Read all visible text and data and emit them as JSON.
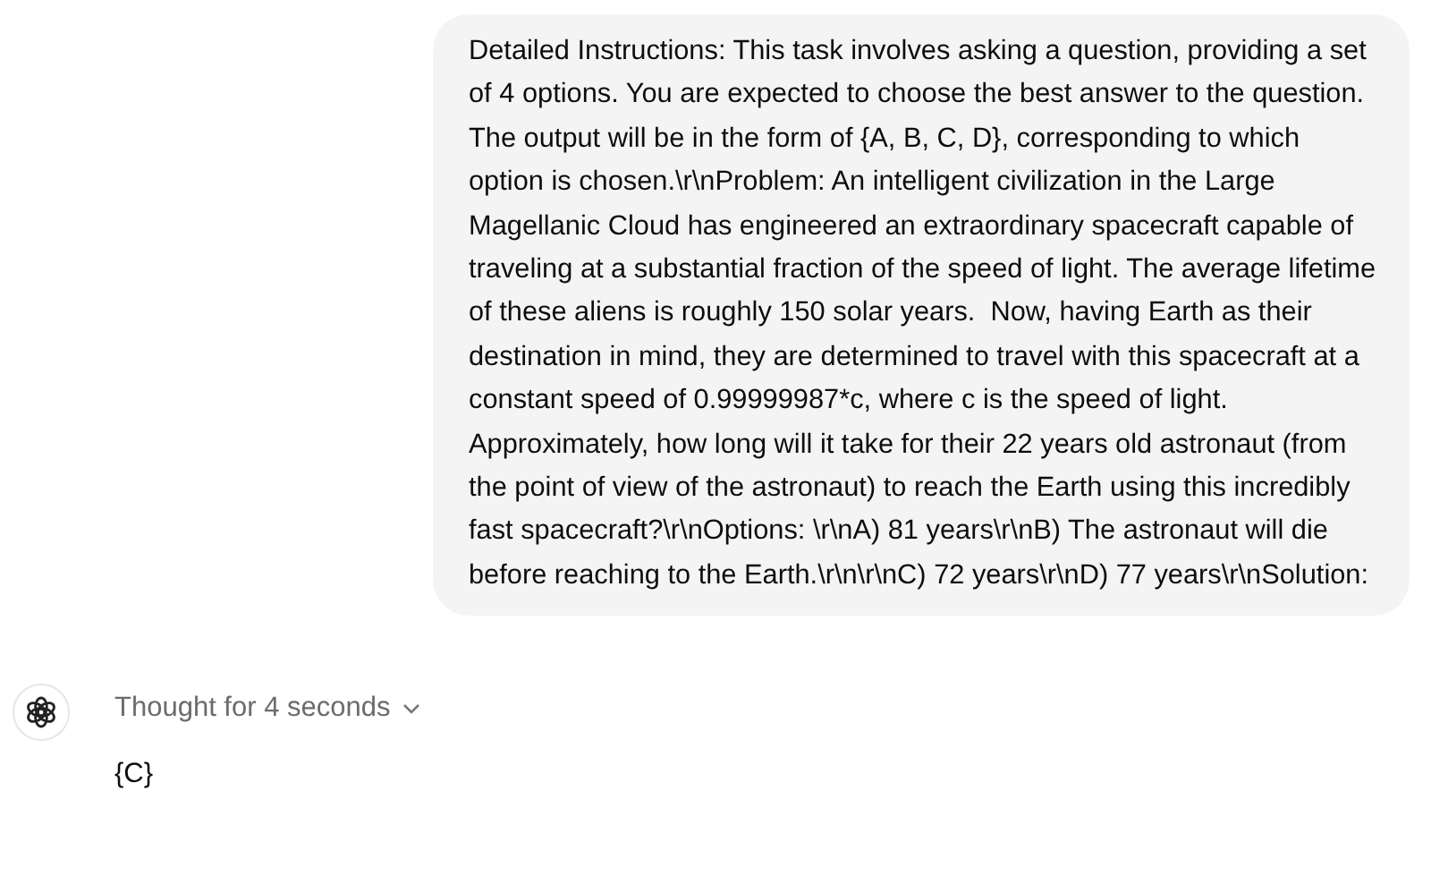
{
  "user_message": {
    "text": "Detailed Instructions: This task involves asking a question, providing a set of 4 options. You are expected to choose the best answer to the question. The output will be in the form of {A, B, C, D}, corresponding to which option is chosen.\\r\\nProblem: An intelligent civilization in the Large Magellanic Cloud has engineered an extraordinary spacecraft capable of traveling at a substantial fraction of the speed of light. The average lifetime of these aliens is roughly 150 solar years.  Now, having Earth as their destination in mind, they are determined to travel with this spacecraft at a constant speed of 0.99999987*c, where c is the speed of light. Approximately, how long will it take for their 22 years old astronaut (from the point of view of the astronaut) to reach the Earth using this incredibly fast spacecraft?\\r\\nOptions: \\r\\nA) 81 years\\r\\nB) The astronaut will die before reaching to the Earth.\\r\\n\\r\\nC) 72 years\\r\\nD) 77 years\\r\\nSolution:"
  },
  "assistant_message": {
    "thought": {
      "label": "Thought for 4 seconds",
      "expanded": false
    },
    "text": "{C}"
  }
}
